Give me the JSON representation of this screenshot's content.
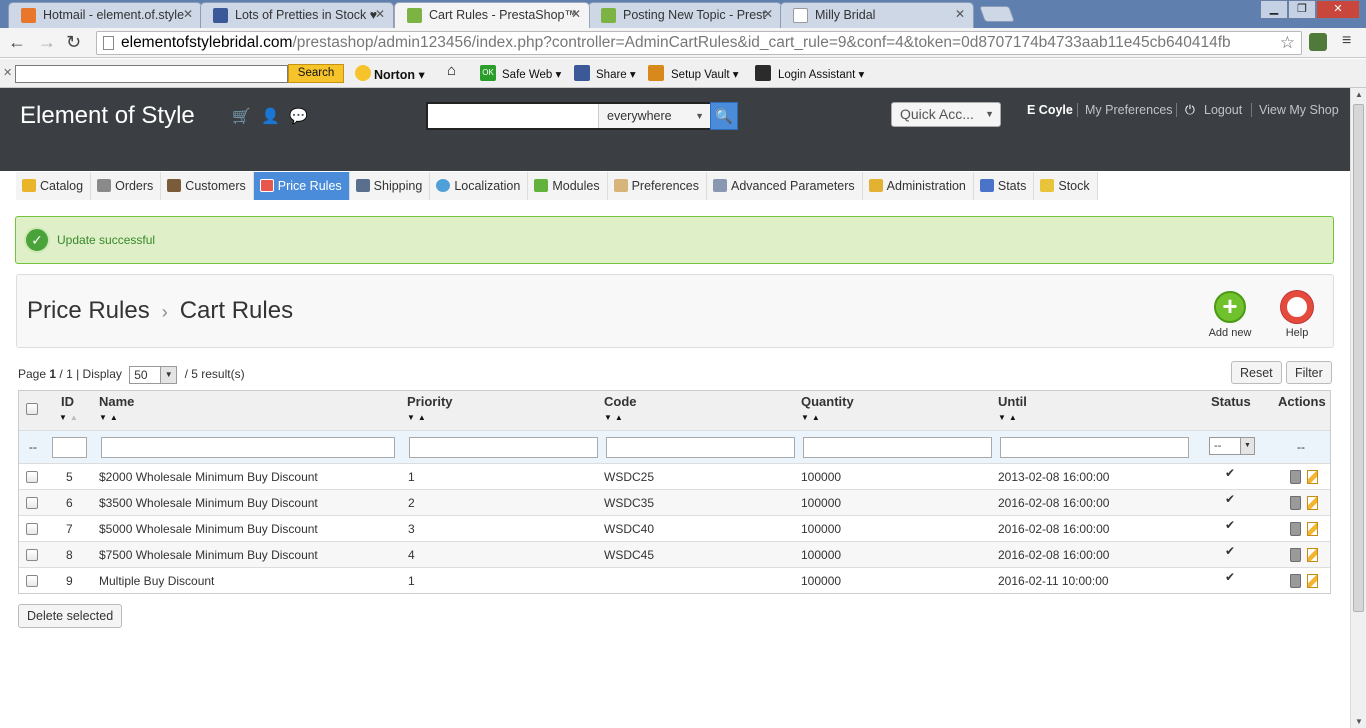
{
  "browser": {
    "tabs": [
      {
        "title": "Hotmail - element.of.style",
        "color": "#e8762b"
      },
      {
        "title": "Lots of Pretties in Stock ♥",
        "color": "#3b5998"
      },
      {
        "title": "Cart Rules - PrestaShop™",
        "color": "#7db343"
      },
      {
        "title": "Posting New Topic - Prest",
        "color": "#7db343"
      },
      {
        "title": "Milly Bridal",
        "color": "#cccccc"
      }
    ],
    "url_domain": "elementofstylebridal.com",
    "url_path": "/prestashop/admin123456/index.php?controller=AdminCartRules&id_cart_rule=9&conf=4&token=0d8707174b4733aab11e45cb640414fb"
  },
  "toolbar2": {
    "search_button": "Search",
    "norton": "Norton",
    "safe_web": "Safe Web",
    "share": "Share",
    "setup_vault": "Setup Vault",
    "login_assistant": "Login Assistant",
    "safe_web_badge": "OK"
  },
  "header": {
    "shop_name": "Element of Style",
    "search_scope": "everywhere",
    "quick_access": "Quick Acc...",
    "user": "E Coyle",
    "my_preferences": "My Preferences",
    "logout": "Logout",
    "view_shop": "View My Shop"
  },
  "menu": [
    {
      "label": "Catalog",
      "icon": "folder-icon",
      "color": "#e9b62b"
    },
    {
      "label": "Orders",
      "icon": "cart-icon",
      "color": "#8a8a8a"
    },
    {
      "label": "Customers",
      "icon": "customers-icon",
      "color": "#7a5b3a"
    },
    {
      "label": "Price Rules",
      "icon": "price-rules-icon",
      "color": "#e8574d"
    },
    {
      "label": "Shipping",
      "icon": "truck-icon",
      "color": "#5a6f8e"
    },
    {
      "label": "Localization",
      "icon": "globe-icon",
      "color": "#4fa0d8"
    },
    {
      "label": "Modules",
      "icon": "puzzle-icon",
      "color": "#63b23c"
    },
    {
      "label": "Preferences",
      "icon": "preferences-icon",
      "color": "#d7b47a"
    },
    {
      "label": "Advanced Parameters",
      "icon": "wrench-icon",
      "color": "#8898b0"
    },
    {
      "label": "Administration",
      "icon": "key-icon",
      "color": "#e3b232"
    },
    {
      "label": "Stats",
      "icon": "stats-icon",
      "color": "#4a73c9"
    },
    {
      "label": "Stock",
      "icon": "stock-icon",
      "color": "#e8c43a"
    }
  ],
  "alert": {
    "message": "Update successful"
  },
  "breadcrumb": {
    "parent": "Price Rules",
    "current": "Cart Rules"
  },
  "toolbar": {
    "add_new": "Add new",
    "help": "Help"
  },
  "list": {
    "page_label": "Page",
    "page_current": "1",
    "page_total": "/ 1 | Display",
    "display": "50",
    "results": "/ 5 result(s)",
    "reset": "Reset",
    "filter": "Filter",
    "filter_dash": "--",
    "status_filter": "--",
    "columns": {
      "id": "ID",
      "name": "Name",
      "priority": "Priority",
      "code": "Code",
      "quantity": "Quantity",
      "until": "Until",
      "status": "Status",
      "actions": "Actions"
    },
    "rows": [
      {
        "id": "5",
        "name": "$2000 Wholesale Minimum Buy Discount",
        "priority": "1",
        "code": "WSDC25",
        "quantity": "100000",
        "until": "2013-02-08 16:00:00",
        "status": "✔"
      },
      {
        "id": "6",
        "name": "$3500 Wholesale Minimum Buy Discount",
        "priority": "2",
        "code": "WSDC35",
        "quantity": "100000",
        "until": "2016-02-08 16:00:00",
        "status": "✔"
      },
      {
        "id": "7",
        "name": "$5000 Wholesale Minimum Buy Discount",
        "priority": "3",
        "code": "WSDC40",
        "quantity": "100000",
        "until": "2016-02-08 16:00:00",
        "status": "✔"
      },
      {
        "id": "8",
        "name": "$7500 Wholesale Minimum Buy Discount",
        "priority": "4",
        "code": "WSDC45",
        "quantity": "100000",
        "until": "2016-02-08 16:00:00",
        "status": "✔"
      },
      {
        "id": "9",
        "name": "Multiple Buy Discount",
        "priority": "1",
        "code": "",
        "quantity": "100000",
        "until": "2016-02-11 10:00:00",
        "status": "✔"
      }
    ],
    "delete_selected": "Delete selected"
  }
}
